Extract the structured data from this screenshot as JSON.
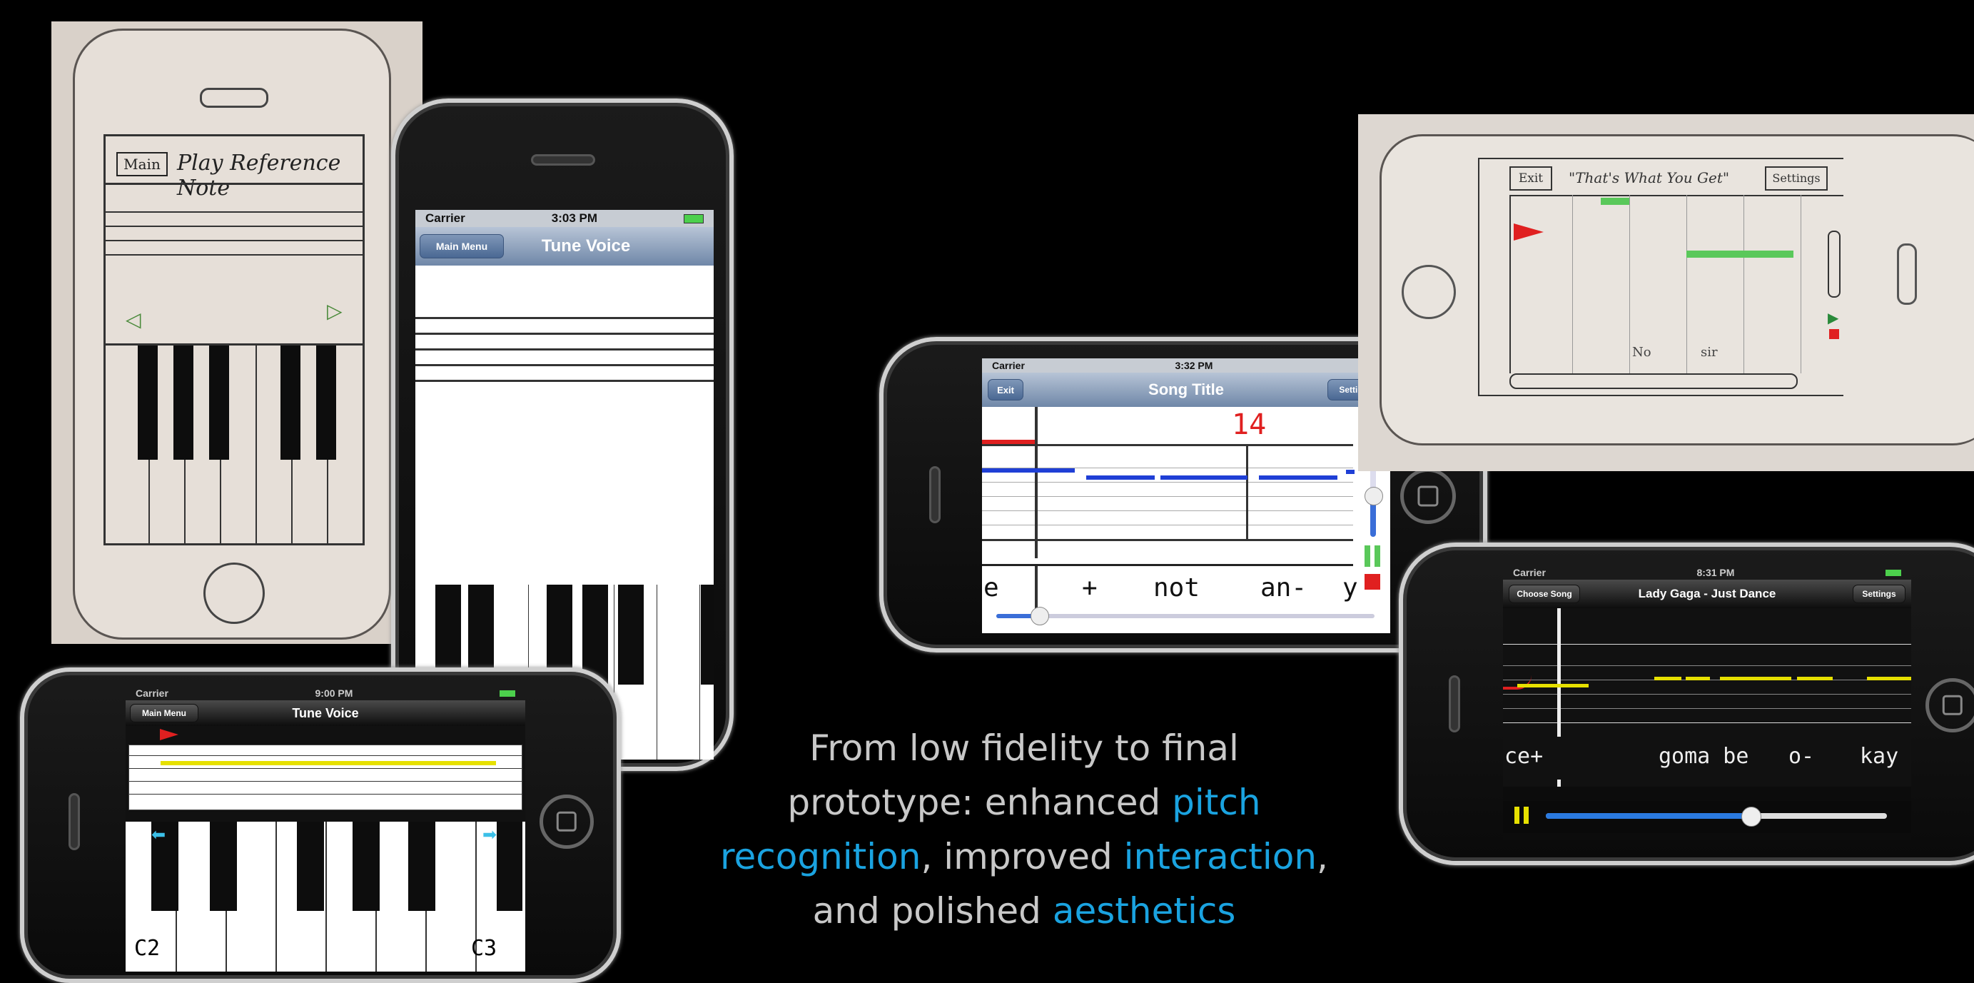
{
  "sketch_portrait": {
    "back_label": "Main",
    "title": "Play Reference Note"
  },
  "iphone_portrait": {
    "status_carrier": "Carrier",
    "status_time": "3:03 PM",
    "nav_back": "Main Menu",
    "nav_title": "Tune Voice"
  },
  "iphone_tuner_landscape": {
    "status_carrier": "Carrier",
    "status_time": "9:00 PM",
    "nav_back": "Main Menu",
    "nav_title": "Tune Voice",
    "key_left_label": "C2",
    "key_right_label": "C3"
  },
  "iphone_song": {
    "status_carrier": "Carrier",
    "status_time": "3:32 PM",
    "exit_label": "Exit",
    "title": "Song Title",
    "settings_label": "Settings",
    "score": "14",
    "lyrics": [
      "e",
      "+",
      "not",
      "an-",
      "y"
    ]
  },
  "sketch_landscape": {
    "exit_label": "Exit",
    "song_title": "\"That's What You Get\"",
    "settings_label": "Settings",
    "lyrics": [
      "No",
      "sir"
    ]
  },
  "iphone_final": {
    "status_carrier": "Carrier",
    "status_time": "8:31 PM",
    "choose_label": "Choose Song",
    "title": "Lady Gaga - Just Dance",
    "settings_label": "Settings",
    "lyrics": [
      "ce+",
      "goma be",
      "o-",
      "kay"
    ],
    "progress": 0.6
  },
  "caption": {
    "line1": "From low fidelity to final",
    "line2_a": "prototype: enhanced ",
    "line2_hl": "pitch",
    "line3_hl1": "recognition",
    "line3_b": ", improved ",
    "line3_hl2": "interaction",
    "line3_c": ",",
    "line4_a": "and polished ",
    "line4_hl": "aesthetics"
  },
  "colors": {
    "accent": "#1aa3e0",
    "yellow_note": "#e6e000",
    "blue_note": "#1f3fd6",
    "green_note": "#5ac85a",
    "red_marker": "#e02020"
  }
}
